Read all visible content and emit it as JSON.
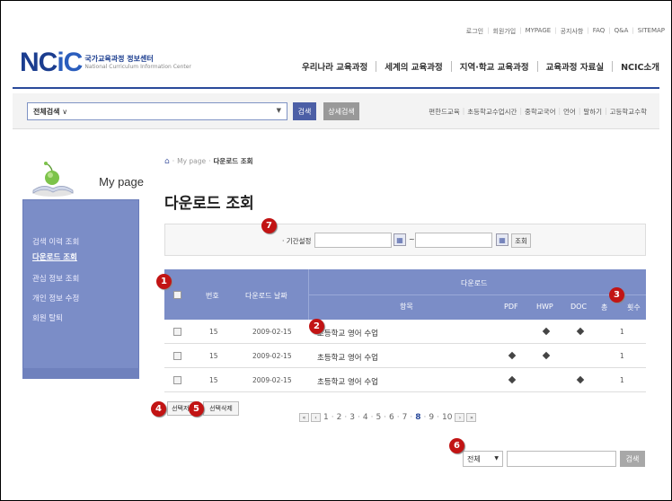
{
  "util_links": [
    "로그인",
    "회원가입",
    "MYPAGE",
    "공지사항",
    "FAQ",
    "Q&A",
    "SITEMAP"
  ],
  "logo": {
    "mark_a": "NC",
    "mark_b": "iC",
    "ko": "국가교육과정 정보센터",
    "en": "National Curriculum Information Center"
  },
  "gnb": [
    "우리나라 교육과정",
    "세계의 교육과정",
    "지역·학교 교육과정",
    "교육과정 자료실",
    "NCIC소개"
  ],
  "search": {
    "selected": "전체검색",
    "search_label": "검색",
    "detail_label": "상세검색"
  },
  "quick_links": [
    "편한드교육",
    "초등학교수업시간",
    "중학교국어",
    "언어",
    "말하기",
    "고등학교수학"
  ],
  "sidebar": {
    "title": "My page",
    "items": [
      {
        "label": "검색 이력 조회",
        "active": false
      },
      {
        "label": "다운로드 조회",
        "active": true
      },
      {
        "label": "관심 정보 조회",
        "active": false
      },
      {
        "label": "개인 정보 수정",
        "active": false
      },
      {
        "label": "회원 탈퇴",
        "active": false
      }
    ]
  },
  "breadcrumb": {
    "root": "My page",
    "sep": "·",
    "current": "다운로드 조회"
  },
  "page_title": "다운로드 조회",
  "period": {
    "label": "· 기간설정",
    "tilde": "~",
    "query_label": "조회"
  },
  "table": {
    "headers": {
      "no": "번호",
      "date": "다운로드 날짜",
      "group": "다운로드",
      "item": "항목",
      "pdf": "PDF",
      "hwp": "HWP",
      "doc": "DOC",
      "count": "총",
      "count2": "횟수"
    },
    "rows": [
      {
        "no": "15",
        "date": "2009-02-15",
        "title": "초등학교 영어 수업",
        "pdf": false,
        "hwp": true,
        "doc": true,
        "count": "1"
      },
      {
        "no": "15",
        "date": "2009-02-15",
        "title": "초등학교 영어 수업",
        "pdf": true,
        "hwp": true,
        "doc": false,
        "count": "1"
      },
      {
        "no": "15",
        "date": "2009-02-15",
        "title": "초등학교 영어 수업",
        "pdf": true,
        "hwp": false,
        "doc": true,
        "count": "1"
      }
    ]
  },
  "buttons": {
    "select_save": "선택저장",
    "select_delete": "선택삭제"
  },
  "pager": {
    "pages": [
      "1",
      "2",
      "3",
      "4",
      "5",
      "6",
      "7",
      "8",
      "9",
      "10"
    ],
    "current": "8"
  },
  "bottom_search": {
    "selected": "전체",
    "button": "검색"
  },
  "badges": [
    "1",
    "2",
    "3",
    "4",
    "5",
    "6",
    "7"
  ],
  "colors": {
    "header_blue": "#7b8dc7",
    "brand": "#1b3d8f",
    "badge_red": "#c21414"
  }
}
